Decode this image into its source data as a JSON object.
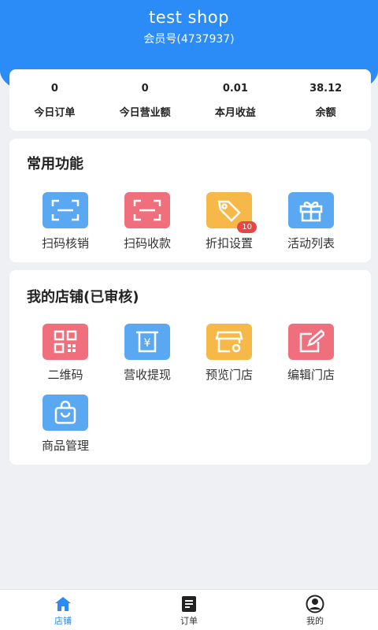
{
  "header": {
    "title": "test shop",
    "member_no": "会员号(4737937)"
  },
  "stats": [
    {
      "value": "0",
      "label": "今日订单"
    },
    {
      "value": "0",
      "label": "今日营业额"
    },
    {
      "value": "0.01",
      "label": "本月收益"
    },
    {
      "value": "38.12",
      "label": "余额"
    }
  ],
  "common": {
    "title": "常用功能",
    "items": [
      {
        "label": "扫码核销",
        "icon": "scan-icon",
        "color": "#5aa8f2"
      },
      {
        "label": "扫码收款",
        "icon": "scan-icon",
        "color": "#ef6f7c"
      },
      {
        "label": "折扣设置",
        "icon": "tag-icon",
        "color": "#f7b84a",
        "badge": "10"
      },
      {
        "label": "活动列表",
        "icon": "gift-icon",
        "color": "#5aa8f2"
      }
    ]
  },
  "store": {
    "title": "我的店铺(已审核)",
    "items": [
      {
        "label": "二维码",
        "icon": "qr-code-icon",
        "color": "#ef6f7c"
      },
      {
        "label": "营收提现",
        "icon": "withdraw-icon",
        "color": "#5aa8f2"
      },
      {
        "label": "预览门店",
        "icon": "storefront-icon",
        "color": "#f7b84a"
      },
      {
        "label": "编辑门店",
        "icon": "edit-icon",
        "color": "#ef6f7c"
      },
      {
        "label": "商品管理",
        "icon": "bag-icon",
        "color": "#5aa8f2"
      }
    ]
  },
  "tabs": [
    {
      "label": "店铺",
      "icon": "home-icon",
      "active": true
    },
    {
      "label": "订单",
      "icon": "order-icon",
      "active": false
    },
    {
      "label": "我的",
      "icon": "profile-icon",
      "active": false
    }
  ]
}
